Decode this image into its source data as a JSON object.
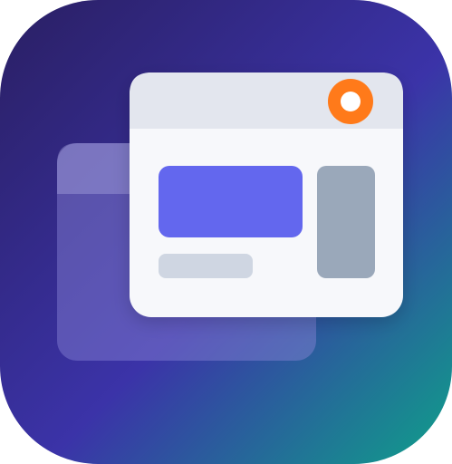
{
  "icon": {
    "name": "app-window-icon",
    "colors": {
      "gradient_start": "#2a1f63",
      "gradient_mid": "#3b33a8",
      "gradient_end": "#0fa08a",
      "back_window_fill": "#8a85d6",
      "front_window_fill": "#f7f8fb",
      "title_bar_fill": "#e3e6ee",
      "hero_block_fill": "#6367ee",
      "side_panel_fill": "#9aa8ba",
      "text_line_fill": "#cfd6e2",
      "status_dot_ring": "#ff7a1a",
      "status_dot_center": "#ffffff"
    }
  }
}
